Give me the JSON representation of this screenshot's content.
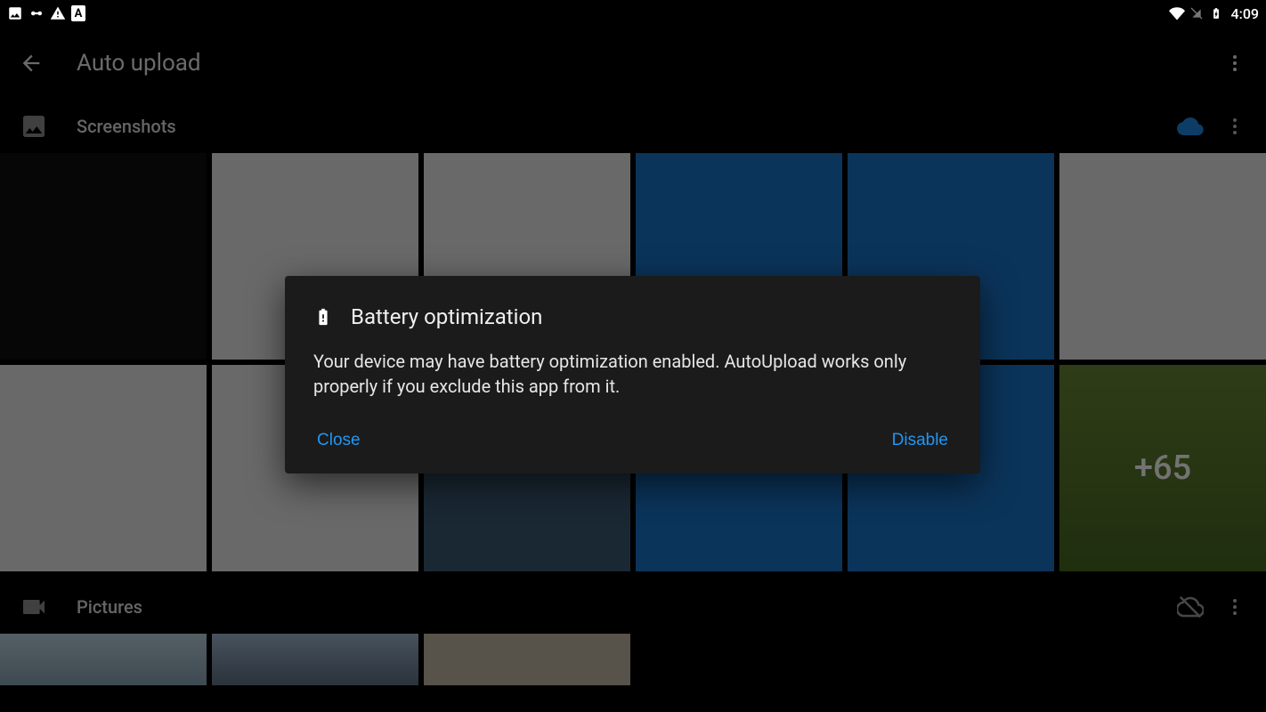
{
  "status": {
    "clock": "4:09"
  },
  "appbar": {
    "title": "Auto upload"
  },
  "sections": {
    "screenshots": {
      "title": "Screenshots",
      "cloud_color": "#1e88e5",
      "more_count_overlay": "+65"
    },
    "pictures": {
      "title": "Pictures",
      "cloud_color": "#9e9e9e"
    }
  },
  "dialog": {
    "title": "Battery optimization",
    "body": "Your device may have battery optimization enabled. AutoUpload works only properly if you exclude this app from it.",
    "close": "Close",
    "disable": "Disable"
  }
}
